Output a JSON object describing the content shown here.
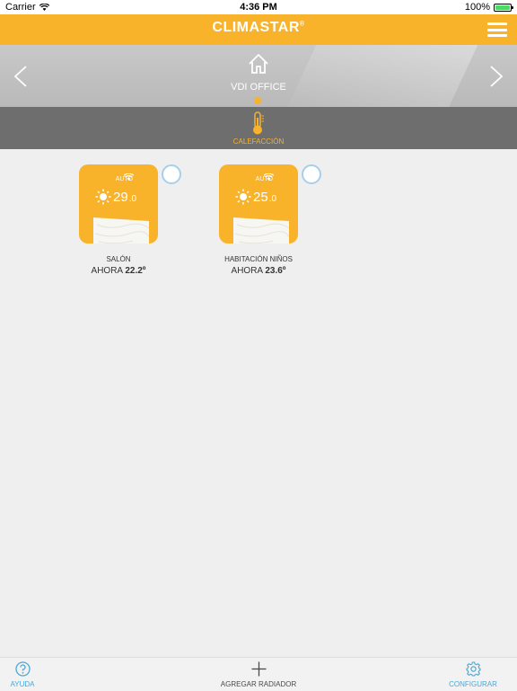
{
  "status_bar": {
    "carrier": "Carrier",
    "time": "4:36 PM",
    "battery": "100%"
  },
  "header": {
    "logo": "CLIMASTAR",
    "logo_mark": "®",
    "menu_icon": "hamburger-icon"
  },
  "location": {
    "name": "VDI OFFICE",
    "icon": "house-icon"
  },
  "mode": {
    "label": "CALEFACCIÓN",
    "icon": "thermometer-icon"
  },
  "devices": [
    {
      "mode": "AUTO",
      "setpoint_int": "29",
      "setpoint_dec": ".0",
      "name": "SALÓN",
      "current_prefix": "AHORA",
      "current": "22.2º"
    },
    {
      "mode": "AUTO",
      "setpoint_int": "25",
      "setpoint_dec": ".0",
      "name": "HABITACIÓN NIÑOS",
      "current_prefix": "AHORA",
      "current": "23.6º"
    }
  ],
  "bottom_bar": {
    "help": "AYUDA",
    "add": "AGREGAR RADIADOR",
    "config": "CONFIGURAR"
  },
  "colors": {
    "accent": "#f8b32b",
    "mode_bar": "#6e6e6e",
    "link": "#4aa8d8"
  }
}
